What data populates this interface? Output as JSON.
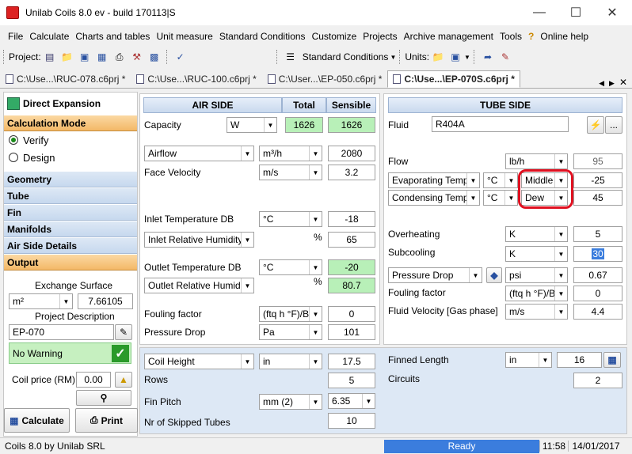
{
  "window": {
    "title": "Unilab Coils 8.0 ev - build 170113|S"
  },
  "menu": [
    "File",
    "Calculate",
    "Charts and tables",
    "Unit measure",
    "Standard Conditions",
    "Customize",
    "Projects",
    "Archive management",
    "Tools",
    "Online help"
  ],
  "toolbar": {
    "project_label": "Project:",
    "std_conditions": "Standard Conditions",
    "units_label": "Units:"
  },
  "tabs": [
    "C:\\Use...\\RUC-078.c6prj *",
    "C:\\Use...\\RUC-100.c6prj *",
    "C:\\User...\\EP-050.c6prj *",
    "C:\\Use...\\EP-070S.c6prj *"
  ],
  "left": {
    "title": "Direct Expansion",
    "calc_mode": "Calculation Mode",
    "verify": "Verify",
    "design": "Design",
    "sections": [
      "Geometry",
      "Tube",
      "Fin",
      "Manifolds",
      "Air Side Details",
      "Output"
    ],
    "exchange_surface_label": "Exchange Surface",
    "exchange_surface_unit": "m²",
    "exchange_surface_value": "7.66105",
    "project_desc_label": "Project Description",
    "project_desc_value": "EP-070",
    "warning": "No Warning",
    "coil_price_label": "Coil price (RM)",
    "coil_price_value": "0.00",
    "calculate": "Calculate",
    "print": "Print"
  },
  "air": {
    "header": "AIR SIDE",
    "total": "Total",
    "sensible": "Sensible",
    "capacity_label": "Capacity",
    "capacity_unit": "W",
    "capacity_total": "1626",
    "capacity_sensible": "1626",
    "airflow_label": "Airflow",
    "airflow_unit": "m³/h",
    "airflow_value": "2080",
    "face_vel_label": "Face Velocity",
    "face_vel_unit": "m/s",
    "face_vel_value": "3.2",
    "inlet_db_label": "Inlet Temperature DB",
    "inlet_db_unit": "°C",
    "inlet_db_value": "-18",
    "inlet_rh_label": "Inlet Relative Humidity",
    "inlet_rh_unit": "%",
    "inlet_rh_value": "65",
    "outlet_db_label": "Outlet Temperature DB",
    "outlet_db_unit": "°C",
    "outlet_db_value": "-20",
    "outlet_rh_label": "Outlet Relative Humidity",
    "outlet_rh_unit": "%",
    "outlet_rh_value": "80.7",
    "fouling_label": "Fouling factor",
    "fouling_unit": "(ftq h °F)/Bt",
    "fouling_value": "0",
    "pdrop_label": "Pressure Drop",
    "pdrop_unit": "Pa",
    "pdrop_value": "101"
  },
  "tube": {
    "header": "TUBE SIDE",
    "fluid_label": "Fluid",
    "fluid_value": "R404A",
    "flow_label": "Flow",
    "flow_unit": "lb/h",
    "flow_value": "95",
    "evap_label": "Evaporating Temp.",
    "evap_unit": "°C",
    "evap_mode": "Middle",
    "evap_value": "-25",
    "cond_label": "Condensing Temp.",
    "cond_unit": "°C",
    "cond_mode": "Dew",
    "cond_value": "45",
    "overheat_label": "Overheating",
    "overheat_unit": "K",
    "overheat_value": "5",
    "subcool_label": "Subcooling",
    "subcool_unit": "K",
    "subcool_value": "30",
    "pdrop_label": "Pressure Drop",
    "pdrop_unit": "psi",
    "pdrop_value": "0.67",
    "fouling_label": "Fouling factor",
    "fouling_unit": "(ftq h °F)/Bt",
    "fouling_value": "0",
    "fluidvel_label": "Fluid Velocity [Gas phase]",
    "fluidvel_unit": "m/s",
    "fluidvel_value": "4.4"
  },
  "geom": {
    "coil_height_label": "Coil Height",
    "coil_height_unit": "in",
    "coil_height_value": "17.5",
    "rows_label": "Rows",
    "rows_value": "5",
    "fin_pitch_label": "Fin Pitch",
    "fin_pitch_unit": "mm (2)",
    "fin_pitch_value": "6.35",
    "skipped_label": "Nr of Skipped Tubes",
    "skipped_value": "10",
    "finned_len_label": "Finned Length",
    "finned_len_unit": "in",
    "finned_len_value": "16",
    "circuits_label": "Circuits",
    "circuits_value": "2"
  },
  "status": {
    "left": "Coils 8.0  by Unilab SRL",
    "ready": "Ready",
    "time": "11:58",
    "date": "14/01/2017"
  }
}
